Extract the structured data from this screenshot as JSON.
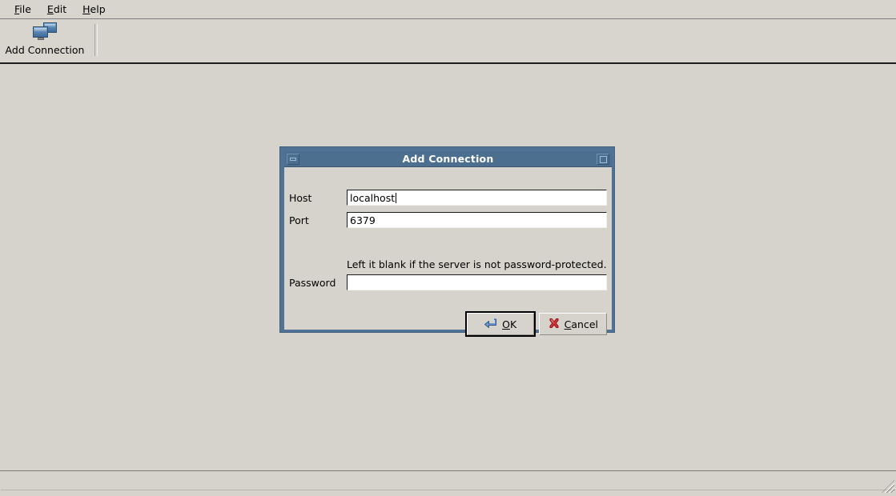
{
  "window": {
    "menubar": [
      {
        "name": "file",
        "mnemonic": "F",
        "rest": "ile"
      },
      {
        "name": "edit",
        "mnemonic": "E",
        "rest": "dit"
      },
      {
        "name": "help",
        "mnemonic": "H",
        "rest": "elp"
      }
    ],
    "toolbar": {
      "add_connection_label": "Add Connection",
      "add_connection_icon": "two-monitors-icon"
    },
    "statusbar": {
      "text": "",
      "grip_icon": "resize-grip-icon"
    }
  },
  "dialog": {
    "title": "Add Connection",
    "titlebar": {
      "minimize_icon": "minimize-icon",
      "maximize_icon": "maximize-icon"
    },
    "fields": {
      "host": {
        "label": "Host",
        "value": "localhost",
        "placeholder": ""
      },
      "port": {
        "label": "Port",
        "value": "6379",
        "placeholder": ""
      },
      "password": {
        "label": "Password",
        "value": "",
        "placeholder": ""
      }
    },
    "hint": "Left it blank if the server is not password-protected.",
    "buttons": {
      "ok": {
        "mnemonic": "O",
        "rest": "K",
        "icon": "enter-arrow-icon"
      },
      "cancel": {
        "pre": "",
        "mnemonic": "C",
        "rest": "ancel",
        "icon": "red-x-icon"
      }
    }
  },
  "colors": {
    "window_background": "#d6d3cc",
    "dialog_frame": "#4f7295",
    "titlebar": "#4c6e8f",
    "titlebar_text": "#ffffff",
    "field_background": "#ffffff",
    "ok_icon": "#5a8ac0",
    "cancel_icon": "#c8272d"
  }
}
